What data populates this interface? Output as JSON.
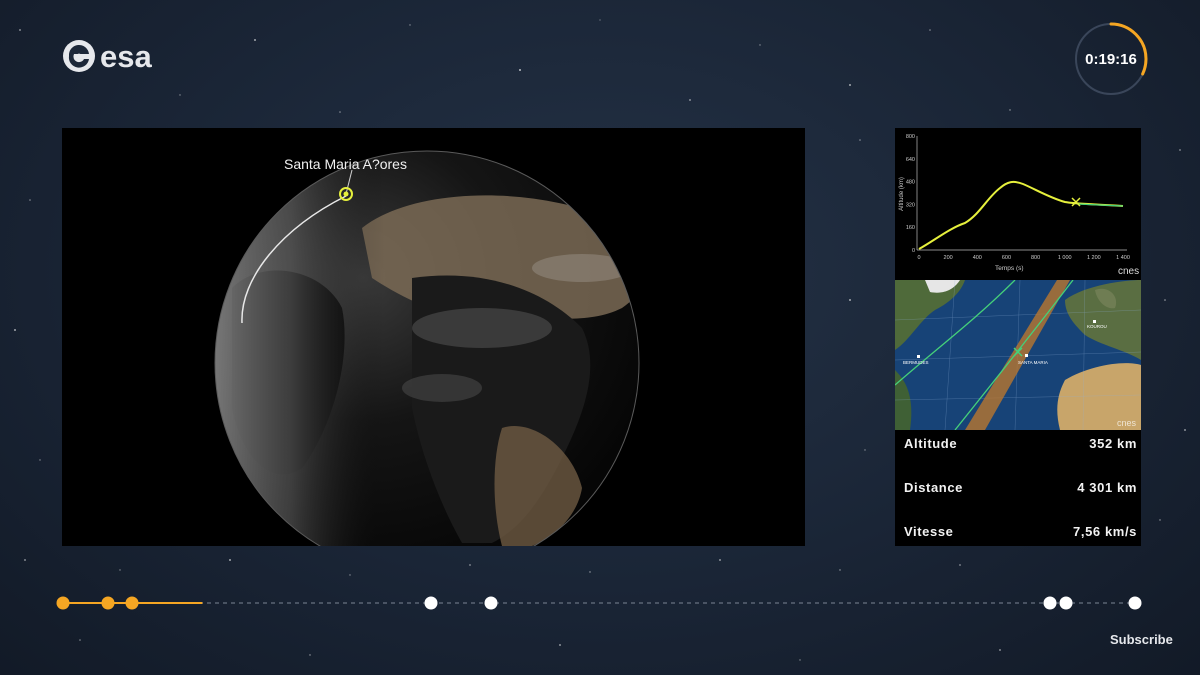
{
  "header": {
    "logo_text": "esa",
    "timer": "0:19:16",
    "timer_progress": 0.32
  },
  "video": {
    "label": "Santa Maria A?ores"
  },
  "graph": {
    "ylabel": "Altitude (km)",
    "xlabel": "Temps (s)",
    "yticks": [
      "800",
      "640",
      "480",
      "320",
      "160",
      "0"
    ],
    "xticks": [
      "0",
      "200",
      "400",
      "600",
      "800",
      "1 000",
      "1 200",
      "1 400"
    ],
    "brand": "cnes"
  },
  "map": {
    "places": [
      "BERMUDES",
      "SANTA MARIA",
      "KOUROU"
    ],
    "brand": "cnes"
  },
  "stats": {
    "altitude_label": "Altitude",
    "altitude_value": "352 km",
    "distance_label": "Distance",
    "distance_value": "4 301 km",
    "vitesse_label": "Vitesse",
    "vitesse_value": "7,56 km/s"
  },
  "timeline": {
    "progress_fraction": 0.13
  },
  "footer": {
    "subscribe_label": "Subscribe"
  },
  "colors": {
    "accent": "#f5a623",
    "curve": "#e6f03c",
    "track": "#45d07a"
  }
}
